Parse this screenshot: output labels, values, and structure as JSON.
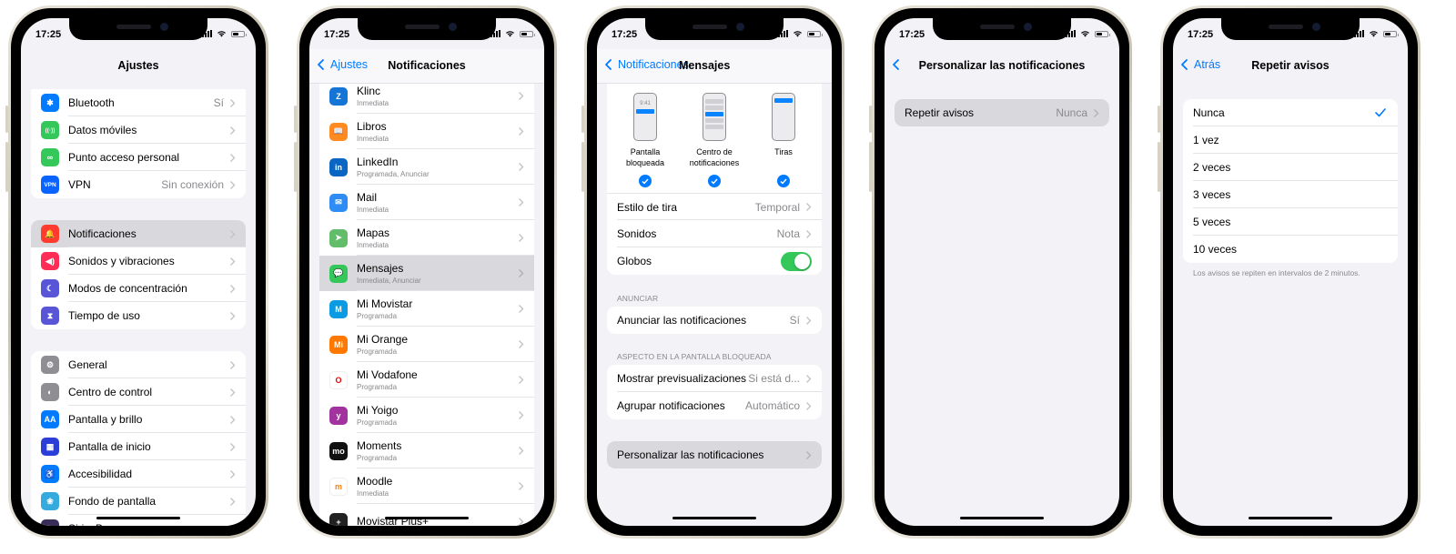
{
  "status_time": "17:25",
  "screens": [
    {
      "title": "Ajustes",
      "groups": [
        [
          {
            "label": "Bluetooth",
            "value": "Sí",
            "icon": "bluetooth-icon",
            "color": "#007aff",
            "glyph": "✱"
          },
          {
            "label": "Datos móviles",
            "value": "",
            "icon": "antenna-icon",
            "color": "#34c759",
            "glyph": "((·))"
          },
          {
            "label": "Punto acceso personal",
            "value": "",
            "icon": "hotspot-icon",
            "color": "#34c759",
            "glyph": "∞"
          },
          {
            "label": "VPN",
            "value": "Sin conexión",
            "icon": "vpn-icon",
            "color": "#0a62ff",
            "glyph": "VPN"
          }
        ],
        [
          {
            "label": "Notificaciones",
            "value": "",
            "icon": "bell-icon",
            "color": "#ff3b30",
            "glyph": "🔔",
            "highlighted": true
          },
          {
            "label": "Sonidos y vibraciones",
            "value": "",
            "icon": "speaker-icon",
            "color": "#ff2d55",
            "glyph": "◀)"
          },
          {
            "label": "Modos de concentración",
            "value": "",
            "icon": "moon-icon",
            "color": "#5856d6",
            "glyph": "☾"
          },
          {
            "label": "Tiempo de uso",
            "value": "",
            "icon": "hourglass-icon",
            "color": "#5856d6",
            "glyph": "⧗"
          }
        ],
        [
          {
            "label": "General",
            "value": "",
            "icon": "gear-icon",
            "color": "#8e8e93",
            "glyph": "⚙"
          },
          {
            "label": "Centro de control",
            "value": "",
            "icon": "switches-icon",
            "color": "#8e8e93",
            "glyph": "◐"
          },
          {
            "label": "Pantalla y brillo",
            "value": "",
            "icon": "text-size-icon",
            "color": "#007aff",
            "glyph": "AA"
          },
          {
            "label": "Pantalla de inicio",
            "value": "",
            "icon": "home-grid-icon",
            "color": "#2c3ed8",
            "glyph": "▦"
          },
          {
            "label": "Accesibilidad",
            "value": "",
            "icon": "accessibility-icon",
            "color": "#007aff",
            "glyph": "♿"
          },
          {
            "label": "Fondo de pantalla",
            "value": "",
            "icon": "flower-icon",
            "color": "#35aadc",
            "glyph": "❀"
          },
          {
            "label": "Siri y Buscar",
            "value": "",
            "icon": "siri-icon",
            "color": "#3a2d5a",
            "glyph": "●"
          }
        ]
      ]
    },
    {
      "title": "Notificaciones",
      "back": "Ajustes",
      "apps": [
        {
          "name": "Klinc",
          "sub": "Inmediata",
          "icon": "klinc-icon",
          "color": "#1475d6",
          "glyph": "Z"
        },
        {
          "name": "Libros",
          "sub": "Inmediata",
          "icon": "books-icon",
          "color": "#ff8a1f",
          "glyph": "📖"
        },
        {
          "name": "LinkedIn",
          "sub": "Programada, Anunciar",
          "icon": "linkedin-icon",
          "color": "#0a66c2",
          "glyph": "in"
        },
        {
          "name": "Mail",
          "sub": "Inmediata",
          "icon": "mail-icon",
          "color": "#2f8cf5",
          "glyph": "✉"
        },
        {
          "name": "Mapas",
          "sub": "Inmediata",
          "icon": "maps-icon",
          "color": "#62bd6a",
          "glyph": "➤"
        },
        {
          "name": "Mensajes",
          "sub": "Inmediata, Anunciar",
          "icon": "messages-icon",
          "color": "#34c759",
          "glyph": "💬",
          "highlighted": true
        },
        {
          "name": "Mi Movistar",
          "sub": "Programada",
          "icon": "movistar-icon",
          "color": "#0b9be3",
          "glyph": "M"
        },
        {
          "name": "Mi Orange",
          "sub": "Programada",
          "icon": "orange-icon",
          "color": "#ff7900",
          "glyph": "Mi"
        },
        {
          "name": "Mi Vodafone",
          "sub": "Programada",
          "icon": "vodafone-icon",
          "color": "#ffffff",
          "glyph": "O"
        },
        {
          "name": "Mi Yoigo",
          "sub": "Programada",
          "icon": "yoigo-icon",
          "color": "#a2339e",
          "glyph": "y"
        },
        {
          "name": "Moments",
          "sub": "Programada",
          "icon": "moments-icon",
          "color": "#111111",
          "glyph": "mo"
        },
        {
          "name": "Moodle",
          "sub": "Inmediata",
          "icon": "moodle-icon",
          "color": "#ffffff",
          "glyph": "m"
        },
        {
          "name": "Movistar Plus+",
          "sub": "",
          "icon": "movistar-plus-icon",
          "color": "#222222",
          "glyph": "+"
        }
      ]
    },
    {
      "title": "Mensajes",
      "back": "Notificaciones",
      "alerts": [
        {
          "label": "Pantalla bloqueada",
          "checked": true,
          "preview_time": "9:41"
        },
        {
          "label": "Centro de notificaciones",
          "checked": true
        },
        {
          "label": "Tiras",
          "checked": true
        }
      ],
      "rows1": [
        {
          "label": "Estilo de tira",
          "value": "Temporal"
        },
        {
          "label": "Sonidos",
          "value": "Nota"
        },
        {
          "label": "Globos",
          "toggle": true
        }
      ],
      "announce_header": "ANUNCIAR",
      "announce_row": {
        "label": "Anunciar las notificaciones",
        "value": "Sí"
      },
      "lock_header": "ASPECTO EN LA PANTALLA BLOQUEADA",
      "lock_rows": [
        {
          "label": "Mostrar previsualizaciones",
          "value": "Si está d..."
        },
        {
          "label": "Agrupar notificaciones",
          "value": "Automático"
        }
      ],
      "customize_row": {
        "label": "Personalizar las notificaciones"
      }
    },
    {
      "title": "Personalizar las notificaciones",
      "row": {
        "label": "Repetir avisos",
        "value": "Nunca"
      }
    },
    {
      "title": "Repetir avisos",
      "back": "Atrás",
      "options": [
        "Nunca",
        "1 vez",
        "2 veces",
        "3 veces",
        "5 veces",
        "10 veces"
      ],
      "selected": "Nunca",
      "footer": "Los avisos se repiten en intervalos de 2 minutos."
    }
  ]
}
